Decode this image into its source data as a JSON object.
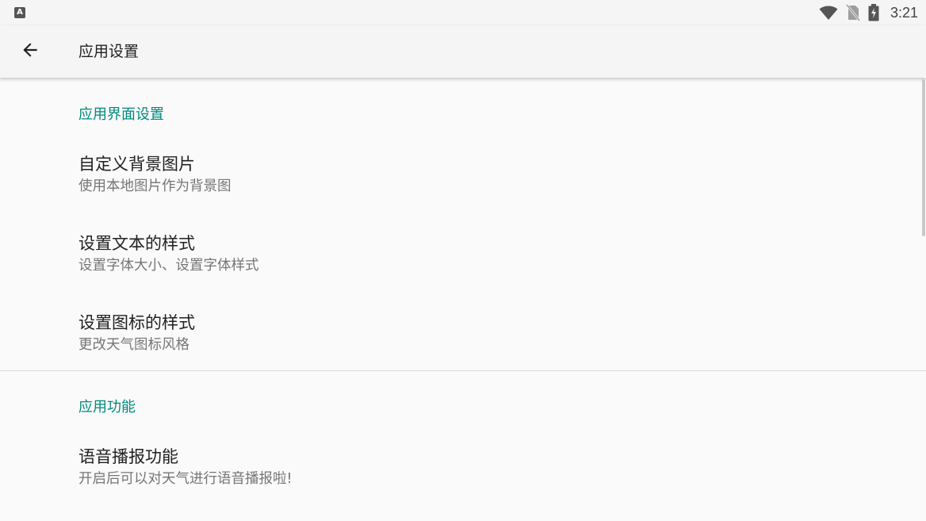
{
  "status_bar": {
    "left_icon": "A",
    "time": "3:21",
    "icons": [
      "wifi-icon",
      "no-sim-icon",
      "battery-charging-icon"
    ]
  },
  "toolbar": {
    "title": "应用设置",
    "back_icon": "arrow-left-icon"
  },
  "categories": [
    {
      "title": "应用界面设置",
      "items": [
        {
          "title": "自定义背景图片",
          "summary": "使用本地图片作为背景图"
        },
        {
          "title": "设置文本的样式",
          "summary": "设置字体大小、设置字体样式"
        },
        {
          "title": "设置图标的样式",
          "summary": "更改天气图标风格"
        }
      ]
    },
    {
      "title": "应用功能",
      "items": [
        {
          "title": "语音播报功能",
          "summary": "开启后可以对天气进行语音播报啦!"
        }
      ]
    }
  ],
  "colors": {
    "accent": "#00897b",
    "background": "#fafafa",
    "toolbar": "#f5f5f5",
    "title_text": "#212121",
    "summary_text": "#757575"
  }
}
